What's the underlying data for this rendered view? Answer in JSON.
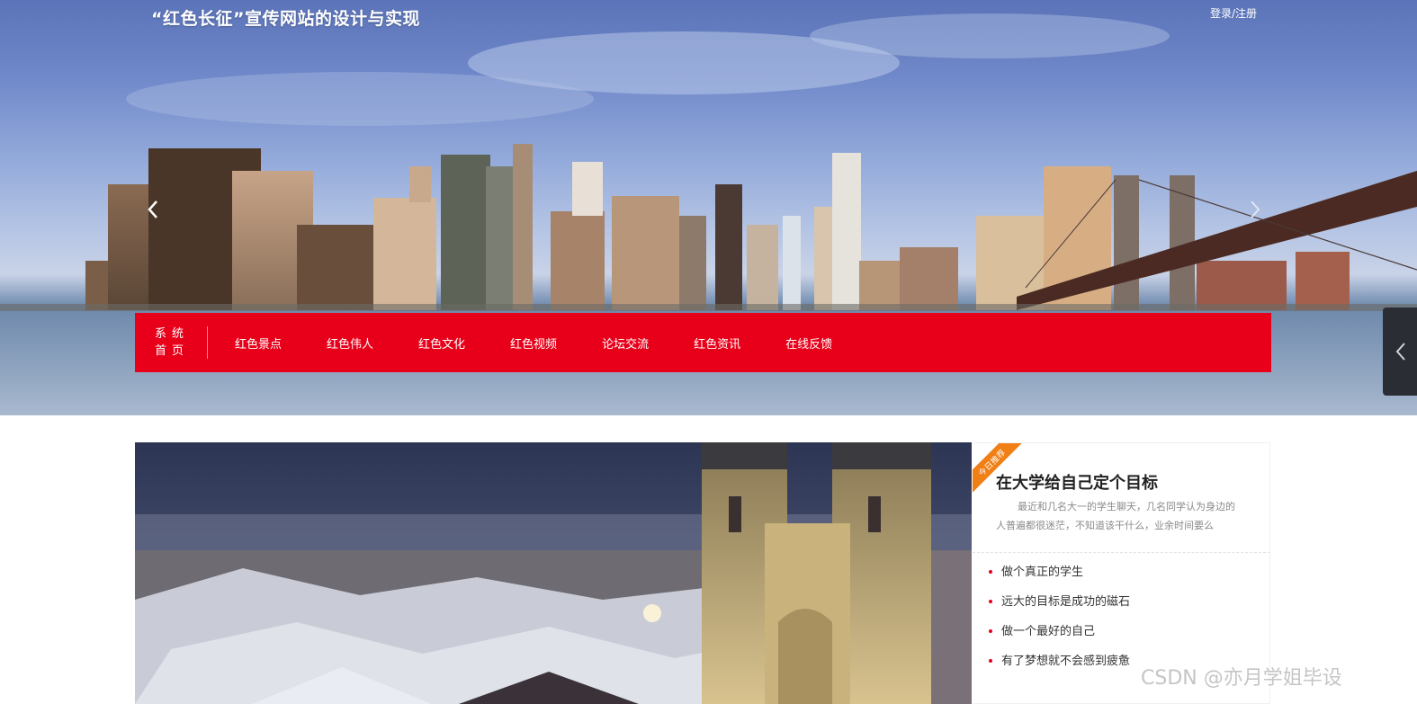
{
  "header": {
    "site_title": "“红色长征”宣传网站的设计与实现",
    "login_label": "登录/注册"
  },
  "banner": {
    "prev_icon": "chevron-left-icon",
    "next_icon": "chevron-right-icon"
  },
  "nav": {
    "home_label": "系统首页",
    "items": [
      "红色景点",
      "红色伟人",
      "红色文化",
      "红色视频",
      "论坛交流",
      "红色资讯",
      "在线反馈"
    ],
    "bar_color": "#e8001a"
  },
  "side_tab": {
    "icon": "chevron-left-icon"
  },
  "recommend": {
    "ribbon_label": "今日推荐",
    "title": "在大学给自己定个目标",
    "summary": "最近和几名大一的学生聊天，几名同学认为身边的人普遍都很迷茫，不知道该干什么，业余时间要么",
    "items": [
      "做个真正的学生",
      "远大的目标是成功的磁石",
      "做一个最好的自己",
      "有了梦想就不会感到疲惫"
    ],
    "accent_color": "#f07f16"
  },
  "watermark": "CSDN @亦月学姐毕设"
}
